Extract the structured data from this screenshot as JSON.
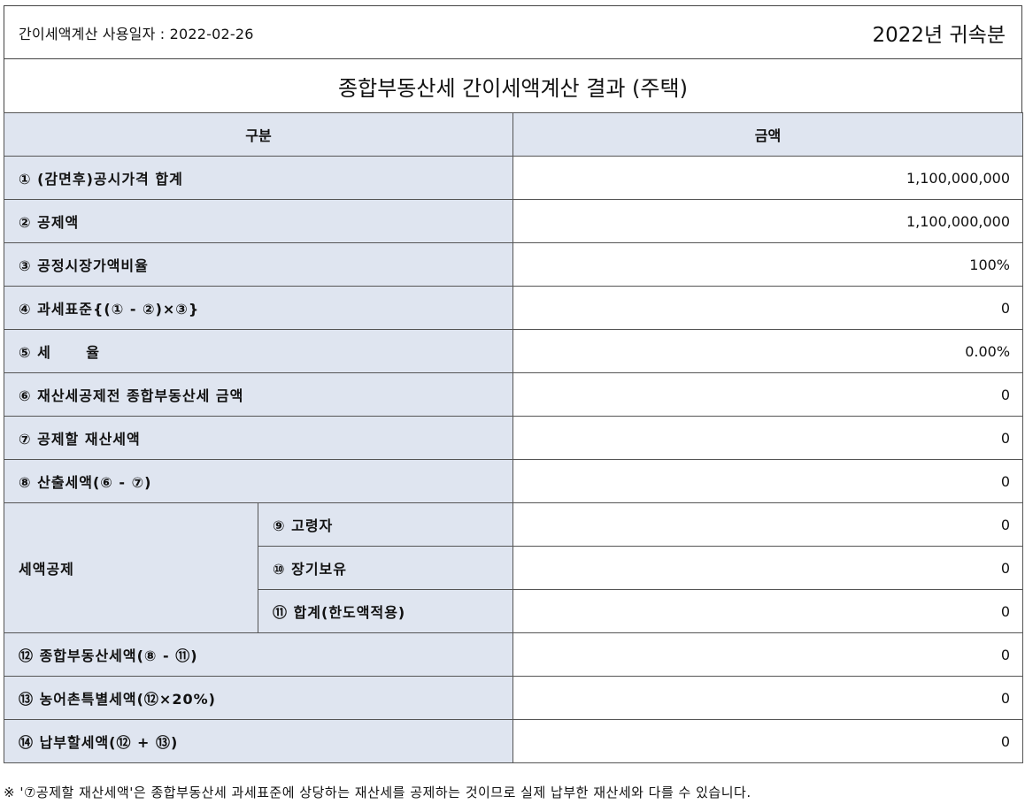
{
  "header": {
    "usage_date_label": "간이세액계산 사용일자 : 2022-02-26",
    "year_label": "2022년 귀속분"
  },
  "title": "종합부동산세 간이세액계산 결과 (주택)",
  "table": {
    "col_category": "구분",
    "col_amount": "금액",
    "rows": [
      {
        "label": "① (감면후)공시가격 합계",
        "value": "1,100,000,000"
      },
      {
        "label": "② 공제액",
        "value": "1,100,000,000"
      },
      {
        "label": "③ 공정시장가액비율",
        "value": "100%"
      },
      {
        "label": "④ 과세표준{(① - ②)×③}",
        "value": "0"
      },
      {
        "label": "⑤ 세      율",
        "value": "0.00%"
      },
      {
        "label": "⑥ 재산세공제전 종합부동산세 금액",
        "value": "0"
      },
      {
        "label": "⑦ 공제할 재산세액",
        "value": "0"
      },
      {
        "label": "⑧ 산출세액(⑥ - ⑦)",
        "value": "0"
      }
    ],
    "group_label": "세액공제",
    "group_rows": [
      {
        "label": "⑨ 고령자",
        "value": "0"
      },
      {
        "label": "⑩ 장기보유",
        "value": "0"
      },
      {
        "label": "⑪ 합계(한도액적용)",
        "value": "0"
      }
    ],
    "tail_rows": [
      {
        "label": "⑫ 종합부동산세액(⑧ - ⑪)",
        "value": "0"
      },
      {
        "label": "⑬ 농어촌특별세액(⑫×20%)",
        "value": "0"
      },
      {
        "label": "⑭ 납부할세액(⑫ + ⑬)",
        "value": "0"
      }
    ]
  },
  "footnote": "※ '⑦공제할 재산세액'은 종합부동산세 과세표준에 상당하는 재산세를 공제하는 것이므로 실제 납부한 재산세와 다를 수 있습니다."
}
